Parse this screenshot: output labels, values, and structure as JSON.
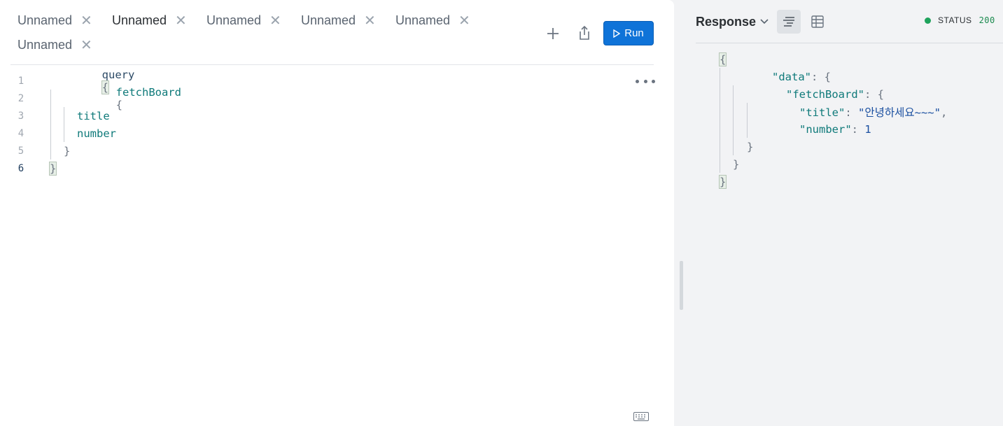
{
  "tabs": [
    {
      "label": "Unnamed",
      "active": false
    },
    {
      "label": "Unnamed",
      "active": true
    },
    {
      "label": "Unnamed",
      "active": false
    },
    {
      "label": "Unnamed",
      "active": false
    },
    {
      "label": "Unnamed",
      "active": false
    },
    {
      "label": "Unnamed",
      "active": false
    }
  ],
  "toolbar": {
    "add_icon": "plus-icon",
    "share_icon": "share-icon",
    "run_label": "Run"
  },
  "editor": {
    "line_numbers": [
      "1",
      "2",
      "3",
      "4",
      "5",
      "6"
    ],
    "current_line": "6",
    "code": {
      "l1_kw": "query",
      "l1_brace": "{",
      "l2_field": "fetchBoard",
      "l2_brace": "{",
      "l3_field": "title",
      "l4_field": "number",
      "l5_brace": "}",
      "l6_brace": "}"
    }
  },
  "response": {
    "title": "Response",
    "status_label": "STATUS",
    "status_code": "200",
    "status_color": "#1fa35c",
    "body": {
      "open": "{",
      "data_key": "\"data\"",
      "fetch_key": "\"fetchBoard\"",
      "title_key": "\"title\"",
      "title_val": "\"안녕하세요~~~\"",
      "number_key": "\"number\"",
      "number_val": "1",
      "colon_brace": ": {",
      "colon": ": ",
      "comma": ",",
      "close": "}"
    }
  },
  "colors": {
    "run_button": "#0f73d8",
    "field_text": "#0f7a7a"
  }
}
